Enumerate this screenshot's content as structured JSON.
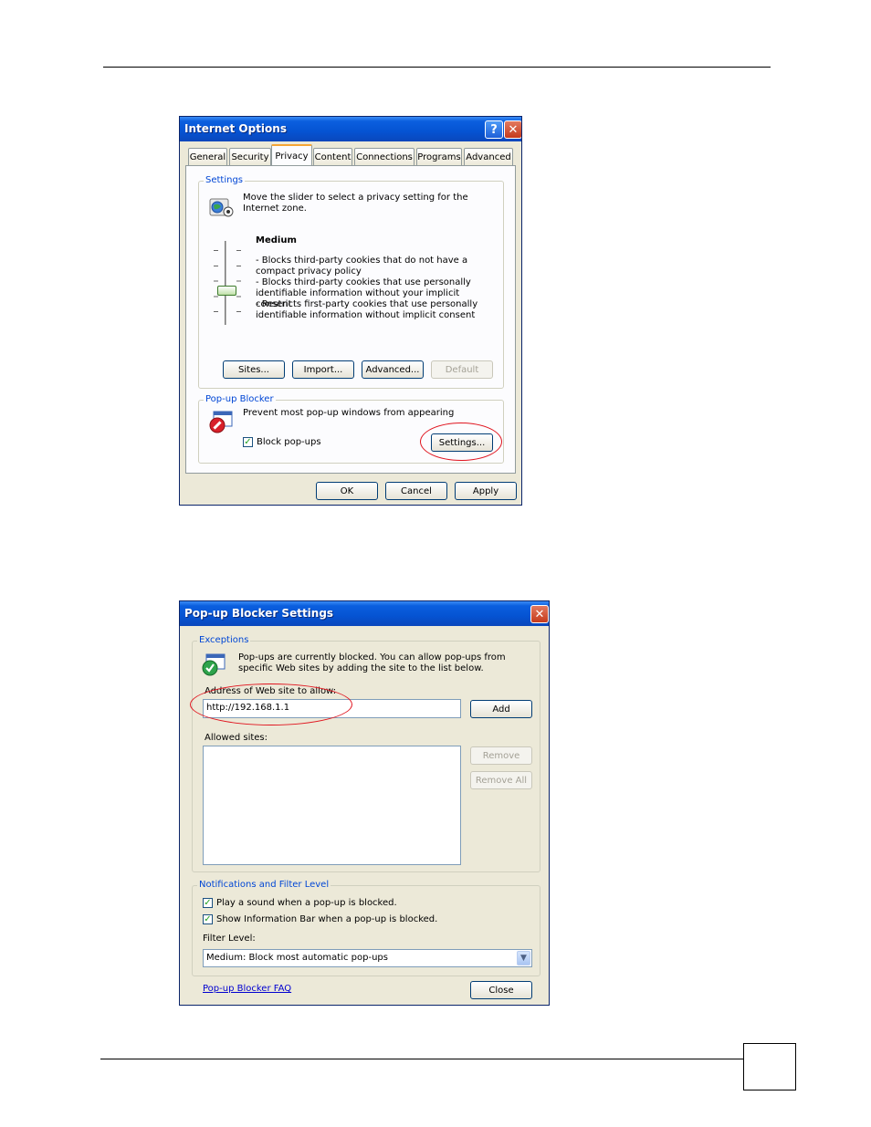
{
  "internet_options": {
    "title": "Internet Options",
    "help_glyph": "?",
    "close_glyph": "✕",
    "tabs": [
      "General",
      "Security",
      "Privacy",
      "Content",
      "Connections",
      "Programs",
      "Advanced"
    ],
    "active_tab": "Privacy",
    "settings": {
      "legend": "Settings",
      "intro": "Move the slider to select a privacy setting for the Internet zone.",
      "level_title": "Medium",
      "bullets": [
        "- Blocks third-party cookies that do not have a compact privacy policy",
        "- Blocks third-party cookies that use personally identifiable information without your implicit consent",
        "- Restricts first-party cookies that use personally identifiable information without implicit consent"
      ],
      "buttons": {
        "sites": "Sites...",
        "import": "Import...",
        "advanced": "Advanced...",
        "default": "Default"
      }
    },
    "popup_blocker": {
      "legend": "Pop-up Blocker",
      "description": "Prevent most pop-up windows from appearing",
      "block_label": "Block pop-ups",
      "block_checked": true,
      "settings_button": "Settings..."
    },
    "footer": {
      "ok": "OK",
      "cancel": "Cancel",
      "apply": "Apply"
    }
  },
  "popup_settings": {
    "title": "Pop-up Blocker Settings",
    "close_glyph": "✕",
    "exceptions": {
      "legend": "Exceptions",
      "info": "Pop-ups are currently blocked.  You can allow pop-ups from specific Web sites by adding the site to the list below.",
      "address_label": "Address of Web site to allow:",
      "address_value": "http://192.168.1.1",
      "add": "Add",
      "allowed_label": "Allowed sites:",
      "remove": "Remove",
      "remove_all": "Remove All"
    },
    "notifications": {
      "legend": "Notifications and Filter Level",
      "sound_label": "Play a sound when a pop-up is blocked.",
      "infobar_label": "Show Information Bar when a pop-up is blocked.",
      "filter_label": "Filter Level:",
      "filter_value": "Medium: Block most automatic pop-ups"
    },
    "faq_link": "Pop-up Blocker FAQ",
    "close": "Close"
  }
}
